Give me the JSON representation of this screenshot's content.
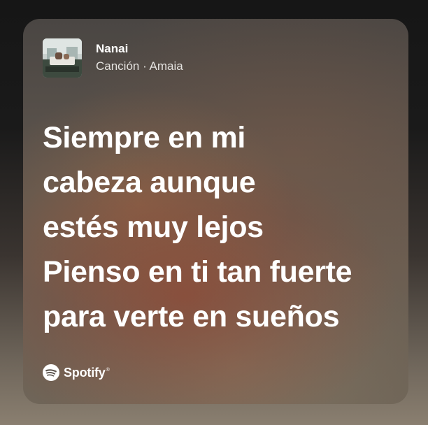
{
  "card": {
    "song_title": "Nanai",
    "subtitle": "Canción · Amaia",
    "lyrics": [
      "Siempre en mi",
      "cabeza aunque",
      "estés muy lejos",
      "Pienso en ti tan fuerte",
      "para verte en sueños"
    ],
    "brand": {
      "name": "Spotify",
      "trademark": "®",
      "icon": "spotify-logo-icon"
    }
  },
  "colors": {
    "text": "#ffffff",
    "subtitle_text": "#e4e2df"
  }
}
